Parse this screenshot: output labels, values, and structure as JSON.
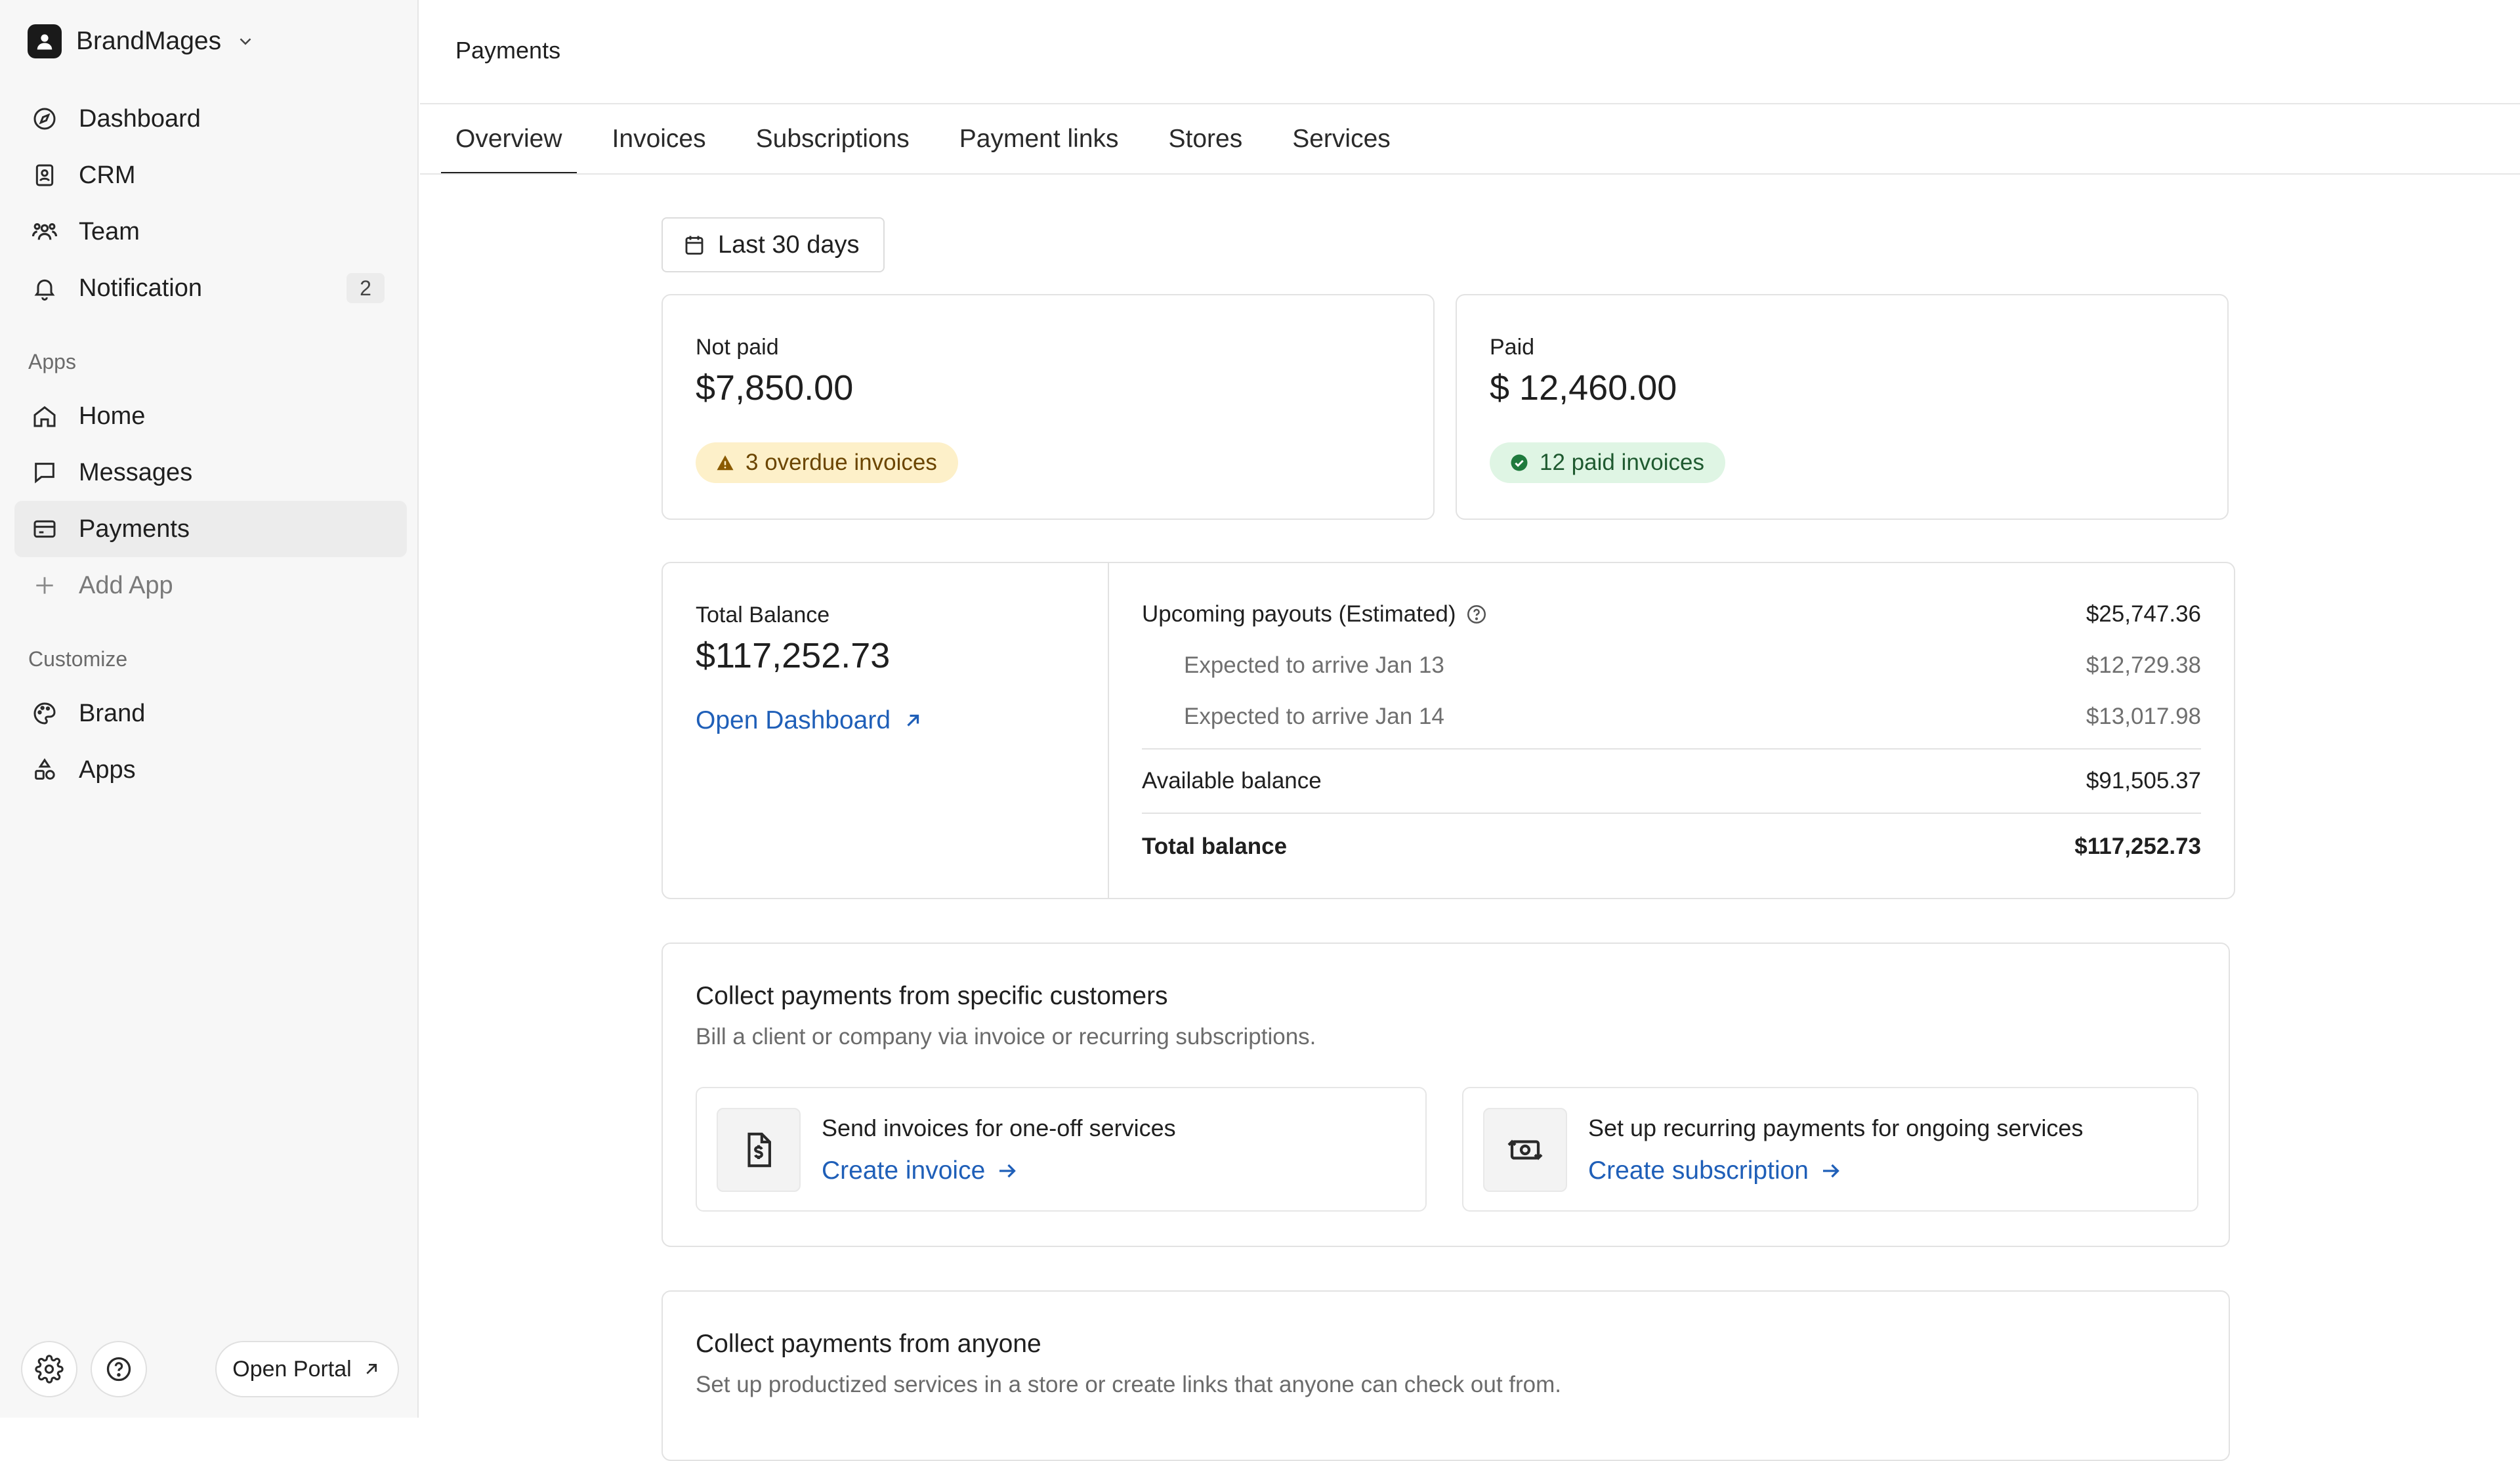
{
  "workspace": {
    "name": "BrandMages"
  },
  "sidebar": {
    "main_items": [
      {
        "label": "Dashboard",
        "icon": "compass-icon"
      },
      {
        "label": "CRM",
        "icon": "contact-book-icon"
      },
      {
        "label": "Team",
        "icon": "team-icon"
      },
      {
        "label": "Notification",
        "icon": "bell-icon",
        "badge": "2"
      }
    ],
    "apps_label": "Apps",
    "apps_items": [
      {
        "label": "Home",
        "icon": "home-icon"
      },
      {
        "label": "Messages",
        "icon": "message-icon"
      },
      {
        "label": "Payments",
        "icon": "credit-card-icon",
        "active": true
      },
      {
        "label": "Add App",
        "icon": "plus-icon"
      }
    ],
    "customize_label": "Customize",
    "customize_items": [
      {
        "label": "Brand",
        "icon": "palette-icon"
      },
      {
        "label": "Apps",
        "icon": "shapes-icon"
      }
    ],
    "footer": {
      "portal_label": "Open Portal"
    }
  },
  "header": {
    "title": "Payments"
  },
  "tabs": [
    {
      "label": "Overview",
      "active": true
    },
    {
      "label": "Invoices"
    },
    {
      "label": "Subscriptions"
    },
    {
      "label": "Payment links"
    },
    {
      "label": "Stores"
    },
    {
      "label": "Services"
    }
  ],
  "filter": {
    "date_range": "Last 30 days"
  },
  "stats": {
    "not_paid": {
      "label": "Not paid",
      "value": "$7,850.00",
      "pill": "3 overdue invoices"
    },
    "paid": {
      "label": "Paid",
      "value": "$ 12,460.00",
      "pill": "12 paid invoices"
    }
  },
  "balance": {
    "label": "Total Balance",
    "value": "$117,252.73",
    "link": "Open Dashboard",
    "payouts": {
      "label": "Upcoming payouts (Estimated)",
      "value": "$25,747.36",
      "rows": [
        {
          "label": "Expected to arrive Jan 13",
          "value": "$12,729.38"
        },
        {
          "label": "Expected to arrive Jan 14",
          "value": "$13,017.98"
        }
      ]
    },
    "available": {
      "label": "Available balance",
      "value": "$91,505.37"
    },
    "total": {
      "label": "Total balance",
      "value": "$117,252.73"
    }
  },
  "collect_specific": {
    "title": "Collect payments from specific customers",
    "desc": "Bill a client or company via invoice or recurring subscriptions.",
    "options": [
      {
        "title": "Send invoices for one-off services",
        "link": "Create invoice",
        "icon": "invoice-dollar-icon"
      },
      {
        "title": "Set up recurring payments for ongoing services",
        "link": "Create subscription",
        "icon": "recurring-money-icon"
      }
    ]
  },
  "collect_anyone": {
    "title": "Collect payments from anyone",
    "desc": "Set up productized services in a store or create links that anyone can check out from."
  },
  "colors": {
    "link": "#1f5fb8",
    "warn_bg": "#fdf0c9",
    "ok_bg": "#dff5e4"
  }
}
